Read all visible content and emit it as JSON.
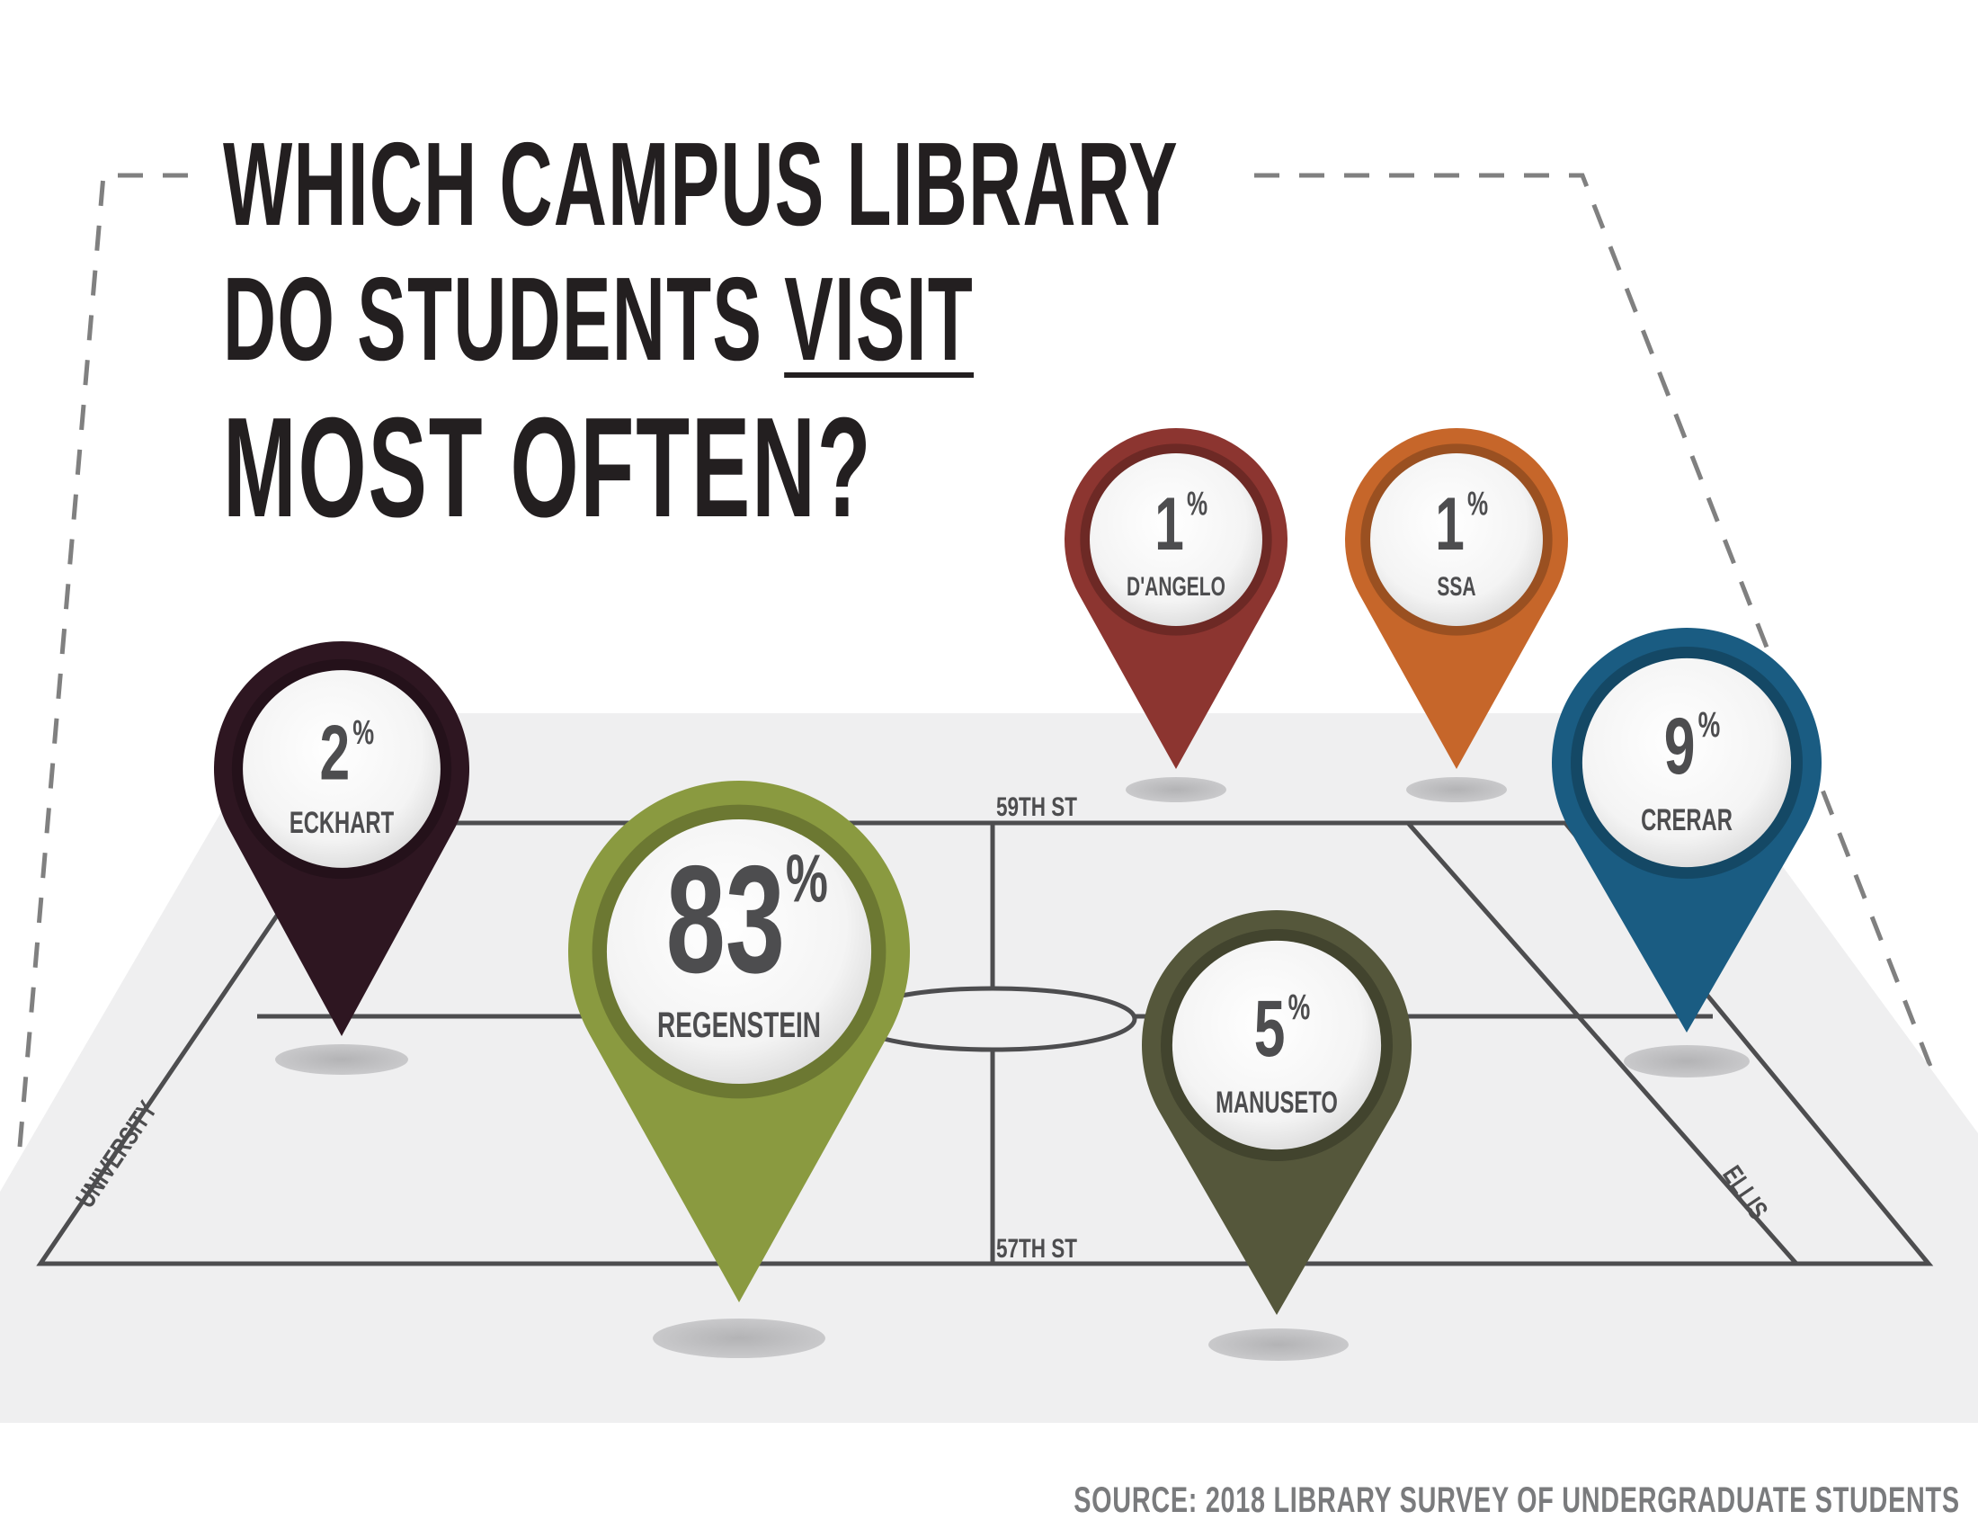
{
  "title": {
    "line1": "WHICH CAMPUS LIBRARY",
    "line2_prefix": "DO STUDENTS ",
    "line2_emphasis": "VISIT",
    "line3": "MOST OFTEN?"
  },
  "source": "SOURCE: 2018 LIBRARY SURVEY OF UNDERGRADUATE STUDENTS",
  "streets": {
    "north": "59TH ST",
    "south": "57TH ST",
    "west": "UNIVERSITY",
    "east": "ELLIS"
  },
  "libraries": [
    {
      "name": "ECKHART",
      "value": "2",
      "unit": "%",
      "color": "#2e1621"
    },
    {
      "name": "REGENSTEIN",
      "value": "83",
      "unit": "%",
      "color": "#8a9a40"
    },
    {
      "name": "D'ANGELO",
      "value": "1",
      "unit": "%",
      "color": "#8c3530"
    },
    {
      "name": "SSA",
      "value": "1",
      "unit": "%",
      "color": "#c6662a"
    },
    {
      "name": "MANUSETO",
      "value": "5",
      "unit": "%",
      "color": "#55573b"
    },
    {
      "name": "CRERAR",
      "value": "9",
      "unit": "%",
      "color": "#1a5c82"
    }
  ]
}
